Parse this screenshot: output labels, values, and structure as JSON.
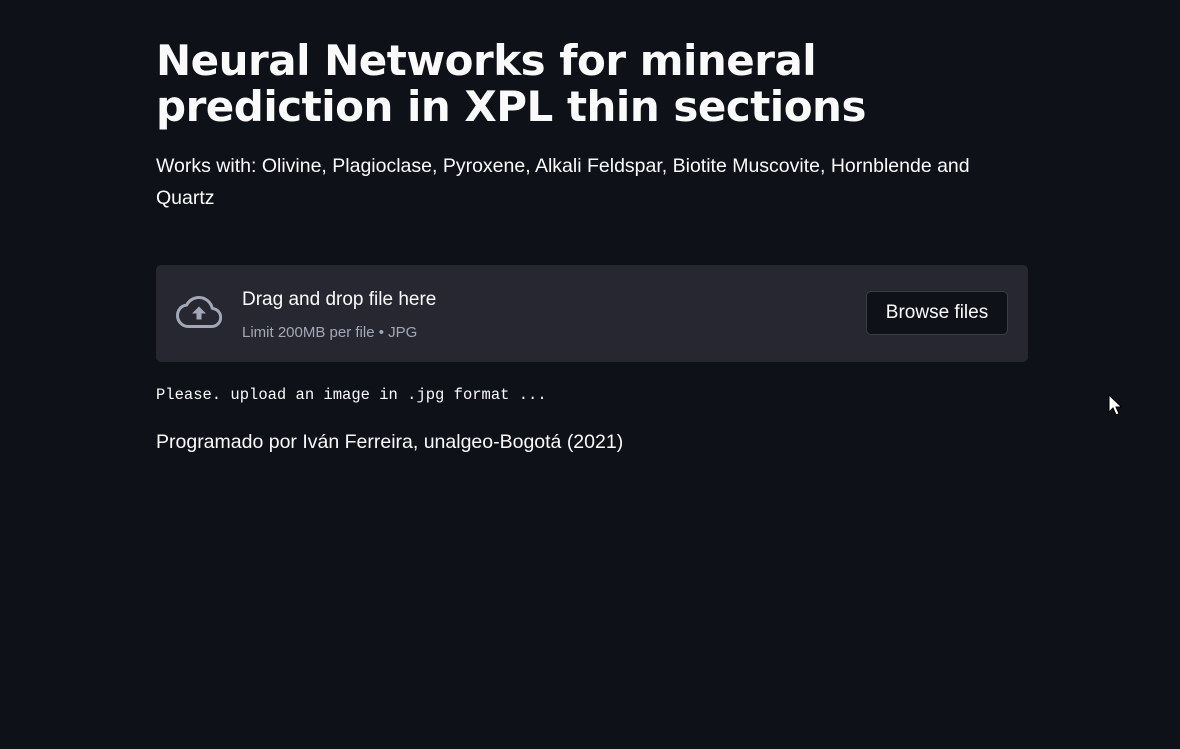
{
  "header": {
    "title": "Neural Networks for mineral prediction in XPL thin sections",
    "subtitle": "Works with: Olivine, Plagioclase, Pyroxene, Alkali Feldspar, Biotite Muscovite, Hornblende and Quartz"
  },
  "uploader": {
    "icon": "cloud-upload-icon",
    "drop_label": "Drag and drop file here",
    "limit_label": "Limit 200MB per file • JPG",
    "browse_label": "Browse files"
  },
  "status": {
    "message": "Please. upload an image in .jpg format ..."
  },
  "footer": {
    "credits": "Programado por Iván Ferreira, unalgeo-Bogotá (2021)"
  },
  "colors": {
    "background": "#0e1117",
    "uploader_bg": "#262730",
    "text": "#fafafa",
    "muted_text": "#a3a8b8"
  }
}
